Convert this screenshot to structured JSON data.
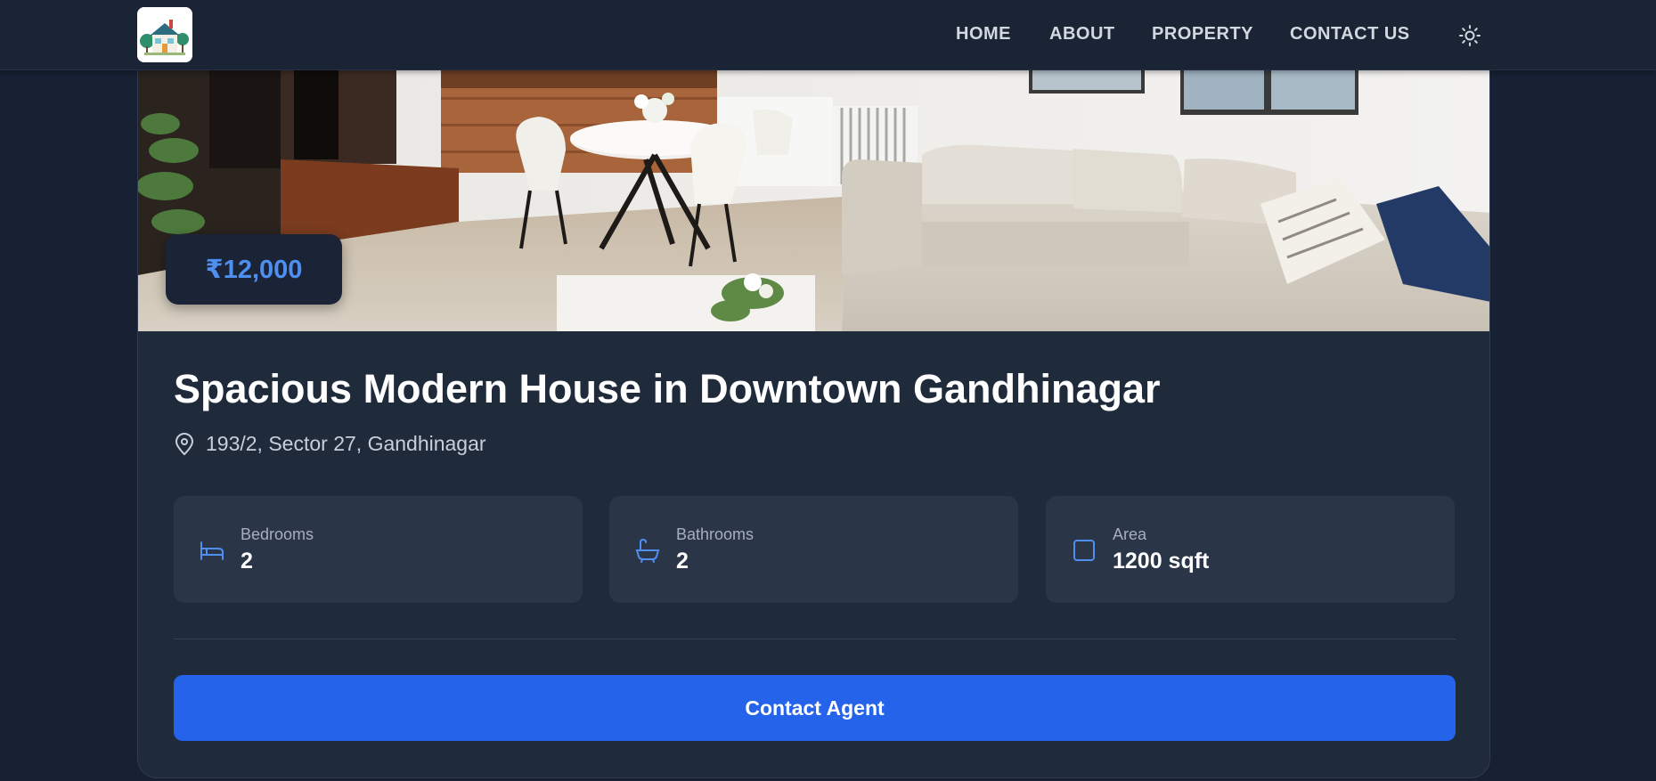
{
  "nav": {
    "home": "HOME",
    "about": "ABOUT",
    "property": "PROPERTY",
    "contact": "CONTACT US"
  },
  "property": {
    "price": "₹12,000",
    "title": "Spacious Modern House in Downtown Gandhinagar",
    "address": "193/2, Sector 27, Gandhinagar",
    "stats": [
      {
        "label": "Bedrooms",
        "value": "2",
        "icon": "bed-icon"
      },
      {
        "label": "Bathrooms",
        "value": "2",
        "icon": "bathtub-icon"
      },
      {
        "label": "Area",
        "value": "1200 sqft",
        "icon": "square-icon"
      }
    ],
    "cta": "Contact Agent"
  },
  "colors": {
    "background": "#172133",
    "card": "#1f2a3b",
    "stat_box": "#2a3548",
    "accent": "#2563eb",
    "price": "#4e8ff0",
    "icon_accent": "#4e8ff0"
  }
}
